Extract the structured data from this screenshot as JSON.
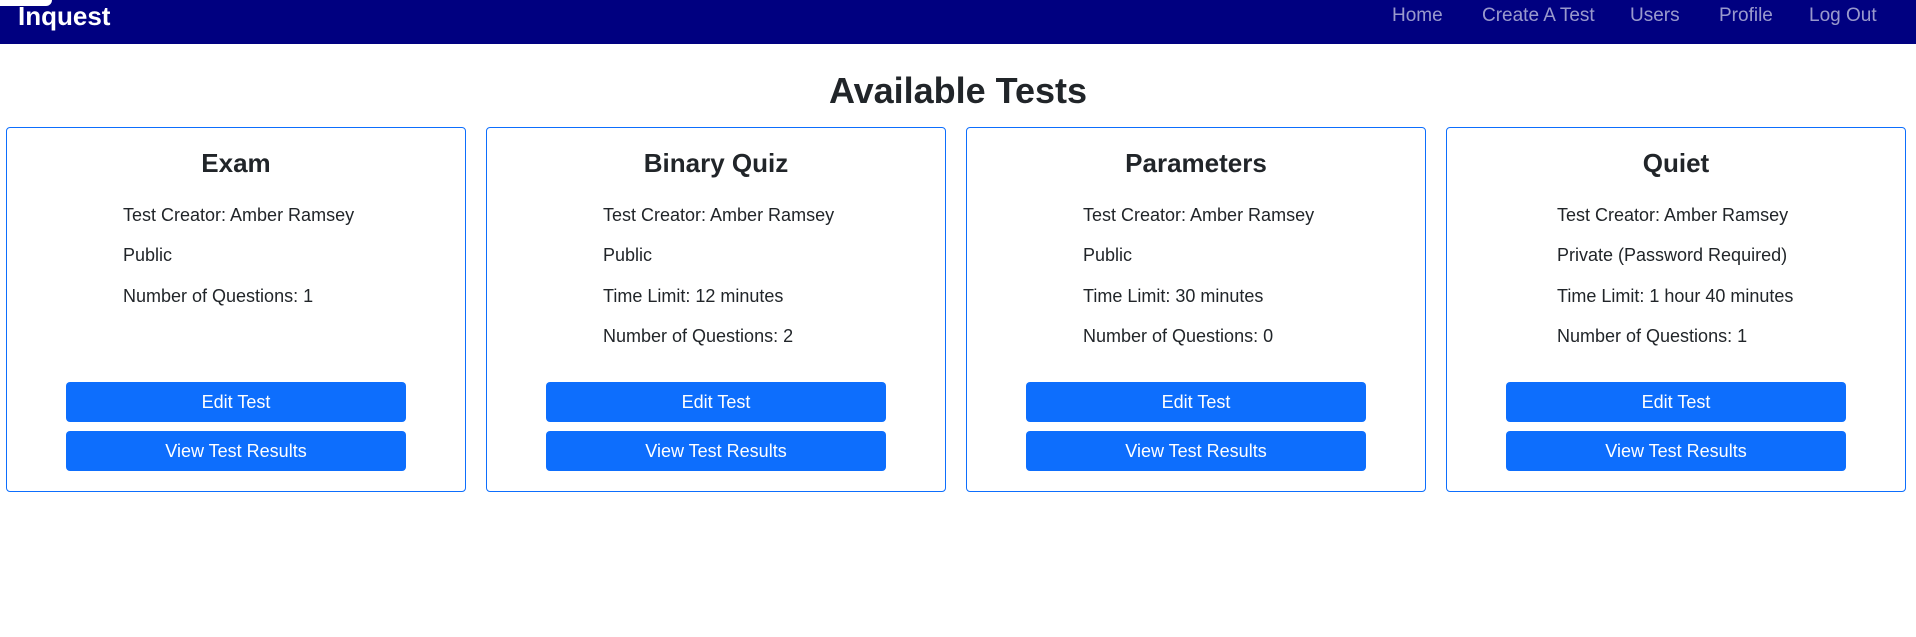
{
  "navbar": {
    "brand": "Inquest",
    "links": [
      "Home",
      "Create A Test",
      "Users",
      "Profile",
      "Log Out"
    ]
  },
  "page_title": "Available Tests",
  "cards": [
    {
      "title": "Exam",
      "lines": [
        "Test Creator: Amber Ramsey",
        "Public",
        "Number of Questions: 1"
      ],
      "edit_label": "Edit Test",
      "results_label": "View Test Results"
    },
    {
      "title": "Binary Quiz",
      "lines": [
        "Test Creator: Amber Ramsey",
        "Public",
        "Time Limit: 12 minutes",
        "Number of Questions: 2"
      ],
      "edit_label": "Edit Test",
      "results_label": "View Test Results"
    },
    {
      "title": "Parameters",
      "lines": [
        "Test Creator: Amber Ramsey",
        "Public",
        "Time Limit: 30 minutes",
        "Number of Questions: 0"
      ],
      "edit_label": "Edit Test",
      "results_label": "View Test Results"
    },
    {
      "title": "Quiet",
      "lines": [
        "Test Creator: Amber Ramsey",
        "Private (Password Required)",
        "Time Limit: 1 hour 40 minutes",
        "Number of Questions: 1"
      ],
      "edit_label": "Edit Test",
      "results_label": "View Test Results"
    }
  ],
  "colors": {
    "navbar": "#000080",
    "accent": "#0d6efd"
  }
}
